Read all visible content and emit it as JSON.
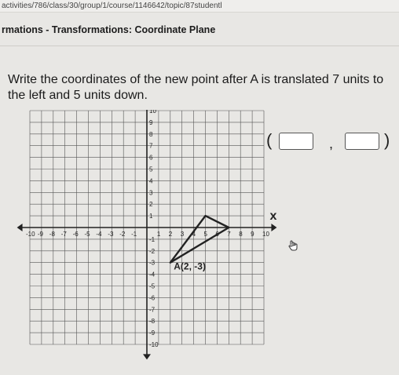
{
  "browser": {
    "url": "activities/786/class/30/group/1/course/1146642/topic/87studentl"
  },
  "course": {
    "title": "rmations - Transformations: Coordinate Plane"
  },
  "question": {
    "text": "Write the coordinates of the new point after A is translated 7 units to the left and 5 units down."
  },
  "answer": {
    "open_paren": "(",
    "comma": ",",
    "close_paren": ")",
    "x_value": "",
    "y_value": ""
  },
  "graph": {
    "y_axis_label": "y",
    "x_axis_label": "x",
    "x_ticks": [
      "-10",
      "-9",
      "-8",
      "-7",
      "-6",
      "-5",
      "-4",
      "-3",
      "-2",
      "-1",
      "1",
      "2",
      "3",
      "4",
      "5",
      "6",
      "7",
      "8",
      "9",
      "10"
    ],
    "y_ticks": [
      "10",
      "9",
      "8",
      "7",
      "6",
      "5",
      "4",
      "3",
      "2",
      "1",
      "-1",
      "-2",
      "-3",
      "-4",
      "-5",
      "-6",
      "-7",
      "-8",
      "-9",
      "-10"
    ],
    "triangle_vertices": [
      [
        5,
        1
      ],
      [
        2,
        -3
      ],
      [
        7,
        0
      ]
    ],
    "point_label": "A(2, -3)",
    "grid_range": [
      -10,
      10
    ],
    "colors": {
      "grid": "#555555",
      "triangle": "#222222"
    }
  },
  "icons": {
    "pointer": "hand-pointer-icon"
  }
}
